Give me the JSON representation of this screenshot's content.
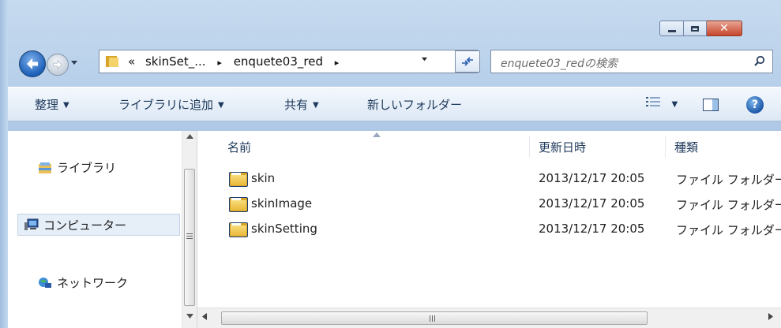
{
  "window": {
    "caption_buttons": {
      "minimize": "minimize",
      "maximize": "maximize",
      "close": "✕"
    }
  },
  "address_bar": {
    "overflow": "«",
    "segments": [
      "skinSet_...",
      "enquete03_red"
    ],
    "separator": "▸"
  },
  "search": {
    "placeholder": "enquete03_redの検索"
  },
  "toolbar": {
    "organize": "整理",
    "add_to_library": "ライブラリに追加",
    "share": "共有",
    "new_folder": "新しいフォルダー",
    "dropdown_arrow": "▼"
  },
  "nav": {
    "items": [
      {
        "label": "ライブラリ",
        "icon": "library-icon"
      },
      {
        "label": "コンピューター",
        "icon": "computer-icon"
      },
      {
        "label": "ネットワーク",
        "icon": "network-icon"
      }
    ]
  },
  "columns": {
    "name": "名前",
    "modified": "更新日時",
    "type": "種類"
  },
  "files": [
    {
      "name": "skin",
      "modified": "2013/12/17 20:05",
      "type": "ファイル フォルダー"
    },
    {
      "name": "skinImage",
      "modified": "2013/12/17 20:05",
      "type": "ファイル フォルダー"
    },
    {
      "name": "skinSetting",
      "modified": "2013/12/17 20:05",
      "type": "ファイル フォルダー"
    }
  ],
  "colors": {
    "accent": "#1e395b",
    "close": "#c7452b",
    "folder": "#e9b83b"
  }
}
